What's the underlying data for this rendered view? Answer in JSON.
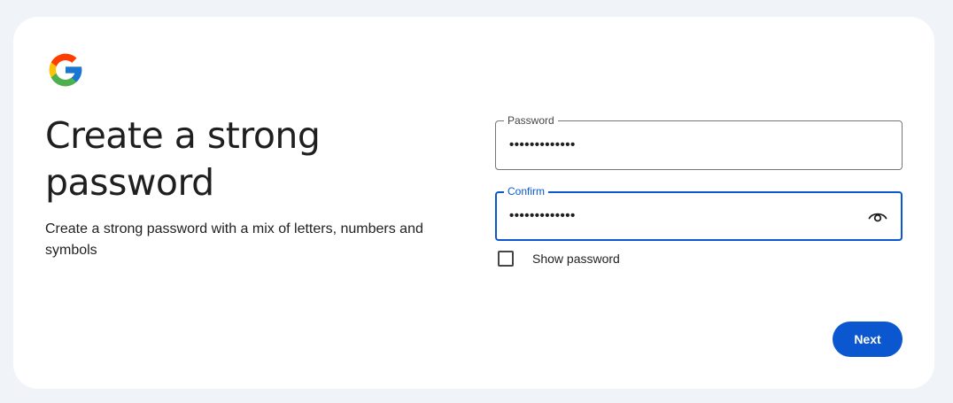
{
  "colors": {
    "page_background": "#f0f4f9",
    "card_background": "#ffffff",
    "accent": "#0b57d0",
    "text_primary": "#1f1f1f",
    "field_border": "#747775"
  },
  "logo": {
    "icon": "google-g-logo"
  },
  "header": {
    "title": "Create a strong password",
    "description": "Create a strong password with a mix of letters, numbers and symbols"
  },
  "form": {
    "password": {
      "label": "Password",
      "value": "•••••••••••••"
    },
    "confirm": {
      "label": "Confirm",
      "value": "•••••••••••••",
      "focused": true,
      "trailing_icon": "eye-icon"
    },
    "show_password": {
      "label": "Show password",
      "checked": false
    }
  },
  "actions": {
    "next_label": "Next"
  }
}
